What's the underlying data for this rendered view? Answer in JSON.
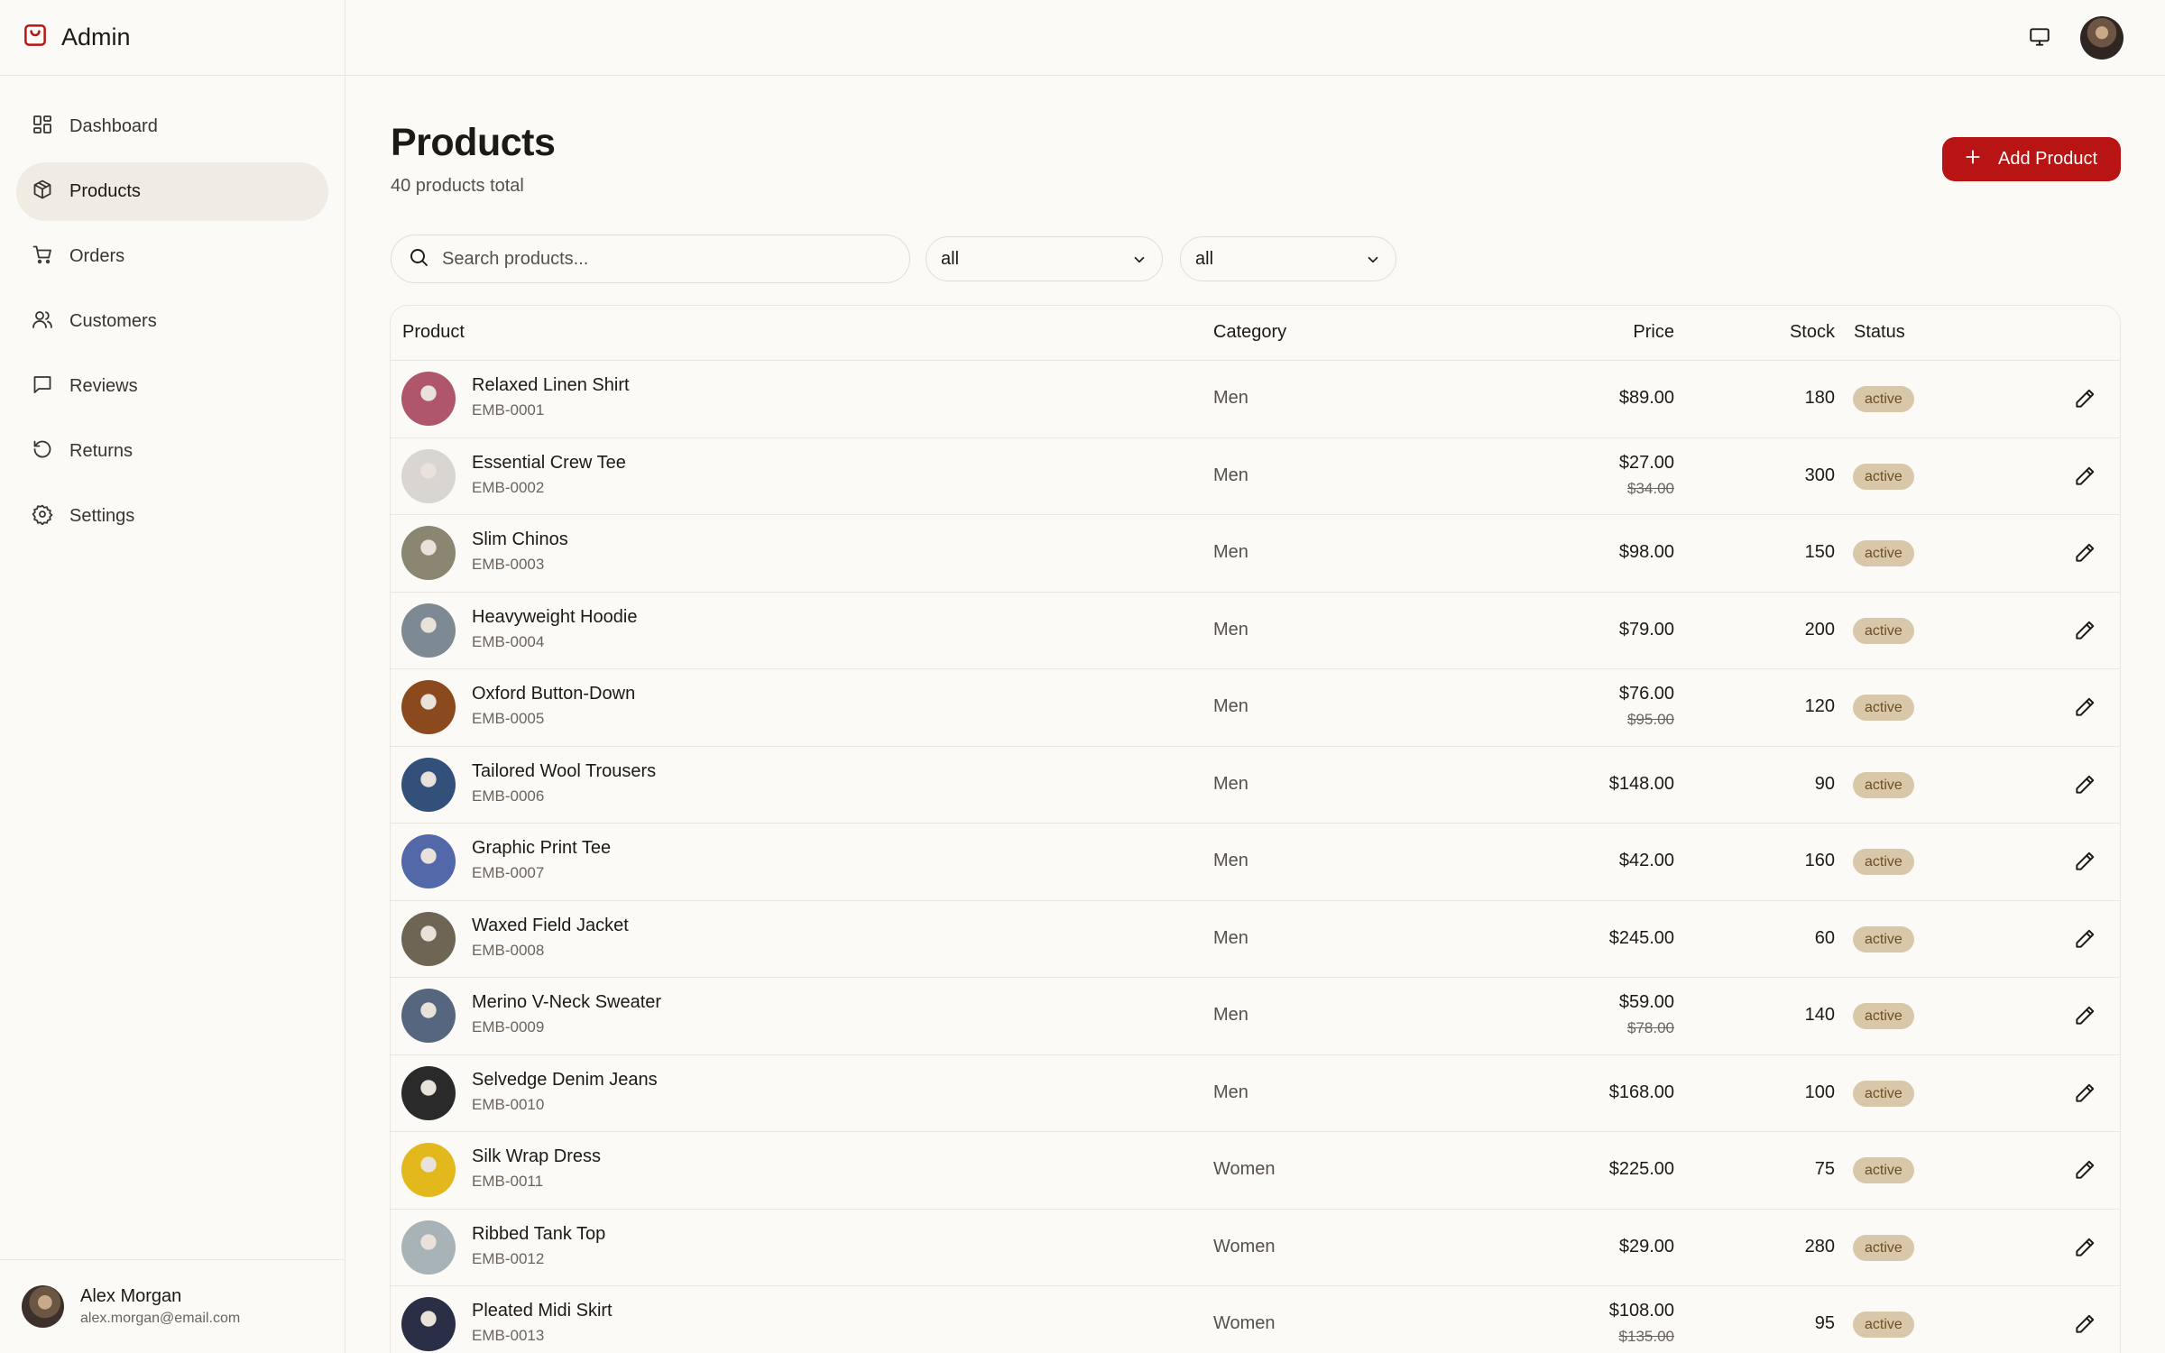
{
  "app": {
    "title": "Admin"
  },
  "sidebar": {
    "items": [
      {
        "label": "Dashboard",
        "icon": "dashboard-icon"
      },
      {
        "label": "Products",
        "icon": "package-icon",
        "active": true
      },
      {
        "label": "Orders",
        "icon": "cart-icon"
      },
      {
        "label": "Customers",
        "icon": "users-icon"
      },
      {
        "label": "Reviews",
        "icon": "message-icon"
      },
      {
        "label": "Returns",
        "icon": "rotate-icon"
      },
      {
        "label": "Settings",
        "icon": "gear-icon"
      }
    ],
    "user": {
      "name": "Alex Morgan",
      "email": "alex.morgan@email.com"
    }
  },
  "header": {
    "monitor_icon": "monitor-icon"
  },
  "page": {
    "title": "Products",
    "subtitle": "40 products total",
    "add_button": "Add Product",
    "search_placeholder": "Search products...",
    "filter_category": "all",
    "filter_status": "all"
  },
  "table": {
    "headers": {
      "product": "Product",
      "category": "Category",
      "price": "Price",
      "stock": "Stock",
      "status": "Status"
    },
    "rows": [
      {
        "name": "Relaxed Linen Shirt",
        "sku": "EMB-0001",
        "category": "Men",
        "price": "$89.00",
        "old_price": "",
        "stock": "180",
        "status": "active",
        "thumb": "#b0566a"
      },
      {
        "name": "Essential Crew Tee",
        "sku": "EMB-0002",
        "category": "Men",
        "price": "$27.00",
        "old_price": "$34.00",
        "stock": "300",
        "status": "active",
        "thumb": "#d9d6d2"
      },
      {
        "name": "Slim Chinos",
        "sku": "EMB-0003",
        "category": "Men",
        "price": "$98.00",
        "old_price": "",
        "stock": "150",
        "status": "active",
        "thumb": "#8a8672"
      },
      {
        "name": "Heavyweight Hoodie",
        "sku": "EMB-0004",
        "category": "Men",
        "price": "$79.00",
        "old_price": "",
        "stock": "200",
        "status": "active",
        "thumb": "#7d8a93"
      },
      {
        "name": "Oxford Button-Down",
        "sku": "EMB-0005",
        "category": "Men",
        "price": "$76.00",
        "old_price": "$95.00",
        "stock": "120",
        "status": "active",
        "thumb": "#8a4a1e"
      },
      {
        "name": "Tailored Wool Trousers",
        "sku": "EMB-0006",
        "category": "Men",
        "price": "$148.00",
        "old_price": "",
        "stock": "90",
        "status": "active",
        "thumb": "#33507a"
      },
      {
        "name": "Graphic Print Tee",
        "sku": "EMB-0007",
        "category": "Men",
        "price": "$42.00",
        "old_price": "",
        "stock": "160",
        "status": "active",
        "thumb": "#5268a8"
      },
      {
        "name": "Waxed Field Jacket",
        "sku": "EMB-0008",
        "category": "Men",
        "price": "$245.00",
        "old_price": "",
        "stock": "60",
        "status": "active",
        "thumb": "#6f6555"
      },
      {
        "name": "Merino V-Neck Sweater",
        "sku": "EMB-0009",
        "category": "Men",
        "price": "$59.00",
        "old_price": "$78.00",
        "stock": "140",
        "status": "active",
        "thumb": "#55667e"
      },
      {
        "name": "Selvedge Denim Jeans",
        "sku": "EMB-0010",
        "category": "Men",
        "price": "$168.00",
        "old_price": "",
        "stock": "100",
        "status": "active",
        "thumb": "#2a2a2a"
      },
      {
        "name": "Silk Wrap Dress",
        "sku": "EMB-0011",
        "category": "Women",
        "price": "$225.00",
        "old_price": "",
        "stock": "75",
        "status": "active",
        "thumb": "#e3b81c"
      },
      {
        "name": "Ribbed Tank Top",
        "sku": "EMB-0012",
        "category": "Women",
        "price": "$29.00",
        "old_price": "",
        "stock": "280",
        "status": "active",
        "thumb": "#a8b3b8"
      },
      {
        "name": "Pleated Midi Skirt",
        "sku": "EMB-0013",
        "category": "Women",
        "price": "$108.00",
        "old_price": "$135.00",
        "stock": "95",
        "status": "active",
        "thumb": "#2b2f45"
      }
    ]
  }
}
